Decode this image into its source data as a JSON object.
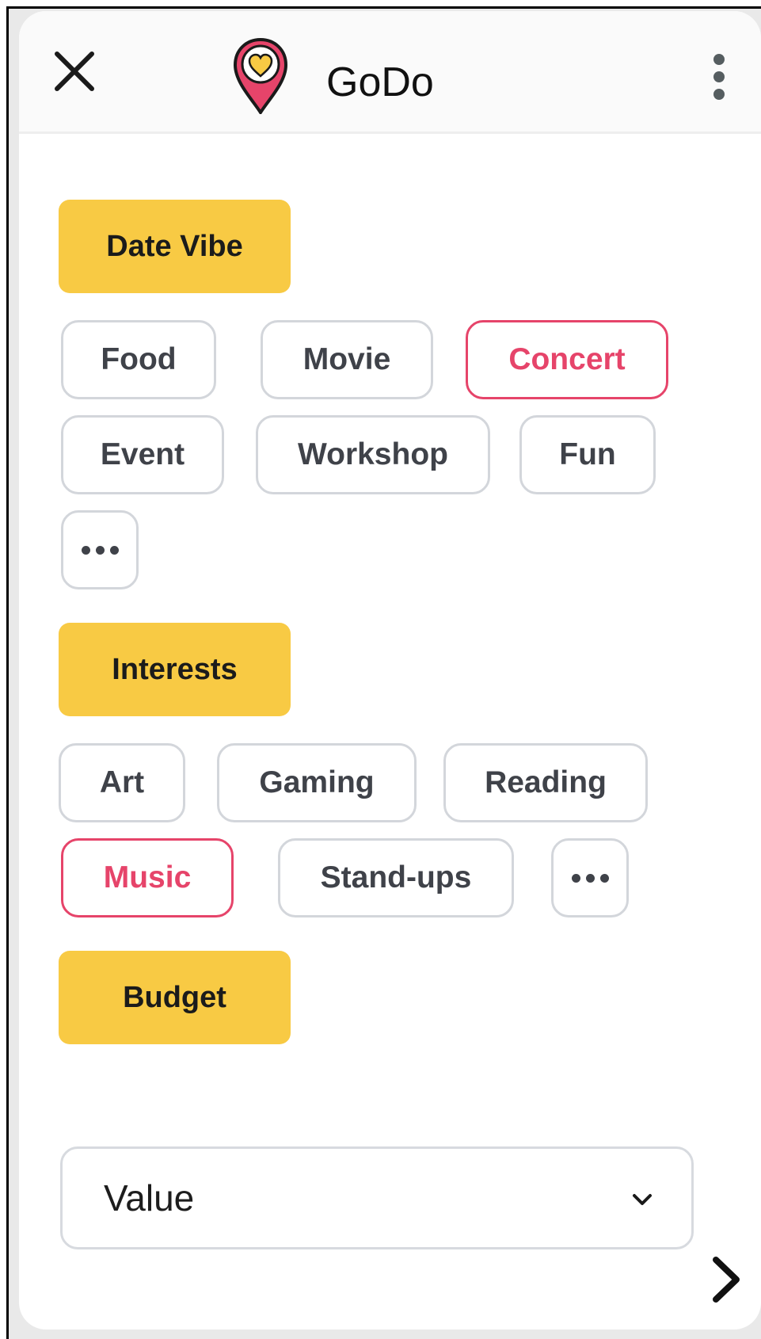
{
  "header": {
    "title": "GoDo",
    "close_icon": "close-icon",
    "menu_icon": "kebab-menu-icon",
    "logo_icon": "heart-location-pin-icon",
    "colors": {
      "pin": "#e6446a",
      "heart": "#f8ca44"
    }
  },
  "date_vibe": {
    "label": "Date Vibe",
    "options": [
      {
        "label": "Food",
        "selected": false
      },
      {
        "label": "Movie",
        "selected": false
      },
      {
        "label": "Concert",
        "selected": true
      },
      {
        "label": "Event",
        "selected": false
      },
      {
        "label": "Workshop",
        "selected": false
      },
      {
        "label": "Fun",
        "selected": false
      }
    ],
    "more_icon": "more-horizontal-icon"
  },
  "interests": {
    "label": "Interests",
    "options": [
      {
        "label": "Art",
        "selected": false
      },
      {
        "label": "Gaming",
        "selected": false
      },
      {
        "label": "Reading",
        "selected": false
      },
      {
        "label": "Music",
        "selected": true
      },
      {
        "label": "Stand-ups",
        "selected": false
      }
    ],
    "more_icon": "more-horizontal-icon"
  },
  "budget": {
    "label": "Budget",
    "select_value": "Value",
    "chevron_icon": "chevron-down-icon"
  },
  "footer": {
    "next_icon": "chevron-right-icon"
  },
  "colors": {
    "section_label_bg": "#f8ca44",
    "selected_accent": "#e6446a",
    "chip_border": "#d3d6db",
    "chip_text": "#3f4249"
  }
}
